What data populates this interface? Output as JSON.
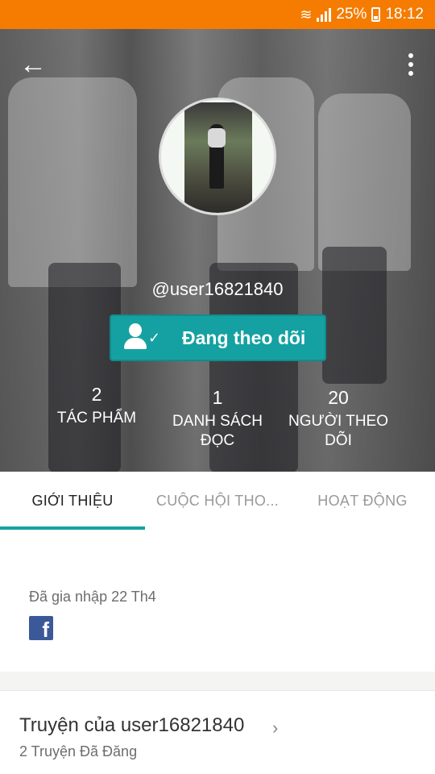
{
  "status_bar": {
    "battery": "25%",
    "time": "18:12"
  },
  "profile": {
    "username": "@user16821840",
    "follow_label": "Đang theo dõi"
  },
  "stats": [
    {
      "value": "2",
      "label_line1": "TÁC PHẨM",
      "label_line2": ""
    },
    {
      "value": "1",
      "label_line1": "DANH SÁCH",
      "label_line2": "ĐỌC"
    },
    {
      "value": "20",
      "label_line1": "NGƯỜI THEO",
      "label_line2": "DÕI"
    }
  ],
  "tabs": [
    {
      "label": "GIỚI THIỆU"
    },
    {
      "label": "CUỘC HỘI THO..."
    },
    {
      "label": "HOẠT ĐỘNG"
    }
  ],
  "about": {
    "joined": "Đã gia nhập 22 Th4",
    "social_icon": "facebook-icon"
  },
  "stories": {
    "title": "Truyện của user16821840",
    "count": "2 Truyện Đã Đăng"
  },
  "colors": {
    "status_bar": "#f57c00",
    "accent": "#15a1a1"
  }
}
